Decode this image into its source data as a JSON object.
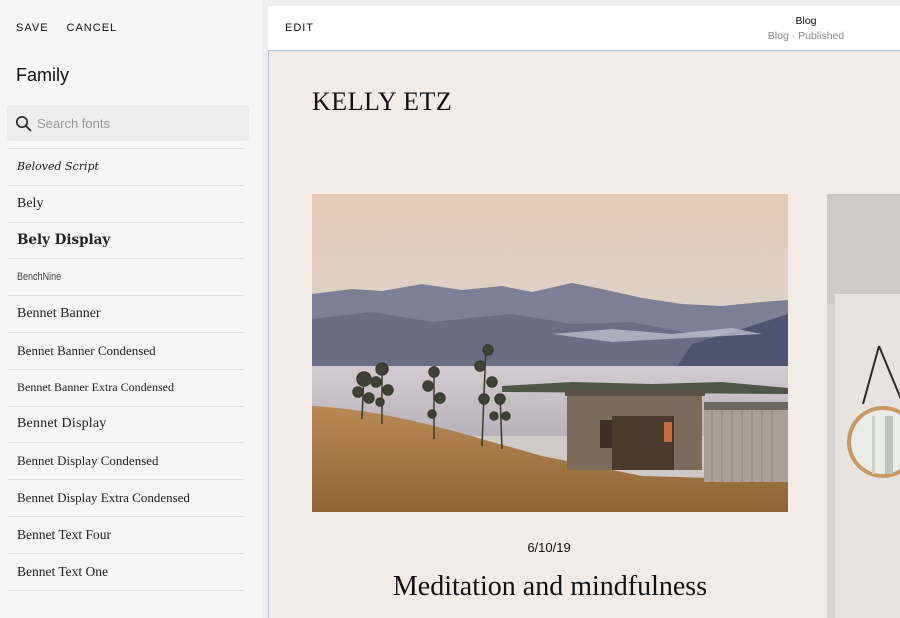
{
  "panel": {
    "save_label": "SAVE",
    "cancel_label": "CANCEL",
    "title": "Family",
    "search_placeholder": "Search fonts",
    "fonts": [
      "Beloved Script",
      "Bely",
      "Bely Display",
      "BenchNine",
      "Bennet Banner",
      "Bennet Banner Condensed",
      "Bennet Banner Extra Condensed",
      "Bennet Display",
      "Bennet Display Condensed",
      "Bennet Display Extra Condensed",
      "Bennet Text Four",
      "Bennet Text One"
    ]
  },
  "editor": {
    "edit_label": "EDIT",
    "page_name": "Blog",
    "page_status": "Blog · Published"
  },
  "site": {
    "title": "KELLY ETZ",
    "post": {
      "date": "6/10/19",
      "title": "Meditation and mindfulness"
    }
  },
  "colors": {
    "panel_bg": "#f6f6f6",
    "site_bg": "#f3ece6",
    "selection_outline": "#a9c8e8"
  },
  "icons": {
    "search": "search-icon"
  }
}
